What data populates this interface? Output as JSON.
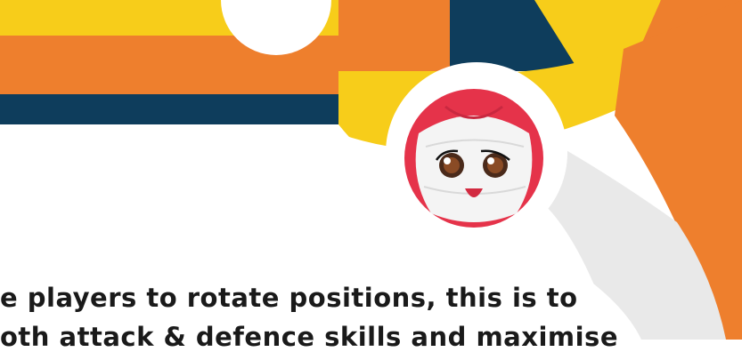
{
  "caption": {
    "line1": "e players to rotate positions, this is to",
    "line2": "oth attack & defence skills and maximise"
  },
  "colors": {
    "orange": "#EE7F2D",
    "yellow": "#F7CD1A",
    "navy": "#0E3D5C",
    "light_grey": "#E9E9E9",
    "ball_red": "#E5334A",
    "white": "#FFFFFF"
  },
  "mascot": {
    "icon": "volleyball-mascot-icon",
    "expression": "smiling face with brown eyes"
  }
}
